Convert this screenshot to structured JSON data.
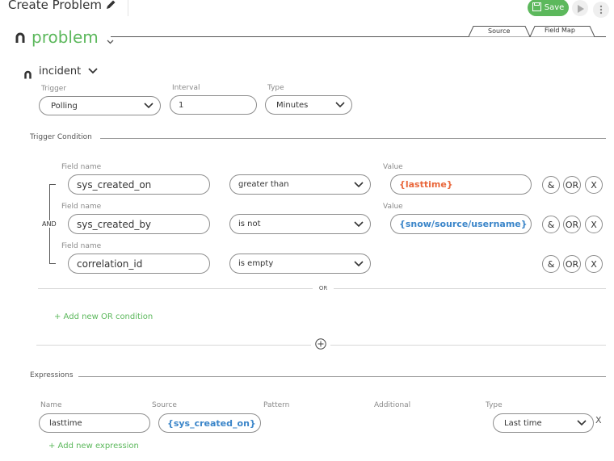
{
  "header": {
    "title": "Create Problem",
    "save_label": "Save"
  },
  "tabs": {
    "source": "Source",
    "field_map": "Field Map"
  },
  "target": {
    "name": "problem"
  },
  "source": {
    "name": "incident",
    "trigger_label": "Trigger",
    "trigger_value": "Polling",
    "interval_label": "Interval",
    "interval_value": "1",
    "type_label": "Type",
    "type_value": "Minutes"
  },
  "trigger_condition": {
    "section_label": "Trigger Condition",
    "and_label": "AND",
    "or_label": "OR",
    "add_or_label": "+ Add new OR condition",
    "field_name_label": "Field name",
    "value_label": "Value",
    "rows": [
      {
        "field": "sys_created_on",
        "operator": "greater than",
        "value": "{lasttime}"
      },
      {
        "field": "sys_created_by",
        "operator": "is not",
        "value": "{snow/source/username}"
      },
      {
        "field": "correlation_id",
        "operator": "is empty",
        "value": ""
      }
    ],
    "btn_and": "&",
    "btn_or": "OR",
    "btn_x": "X"
  },
  "expressions": {
    "section_label": "Expressions",
    "name_label": "Name",
    "source_label": "Source",
    "pattern_label": "Pattern",
    "additional_label": "Additional",
    "type_label": "Type",
    "name_value": "lasttime",
    "source_value": "{sys_created_on}",
    "type_value": "Last time",
    "remove_label": "X",
    "add_label": "+ Add new expression"
  },
  "colors": {
    "accent": "#5cb85c",
    "variable_blue": "#3a85c9",
    "variable_orange": "#e9673b"
  }
}
